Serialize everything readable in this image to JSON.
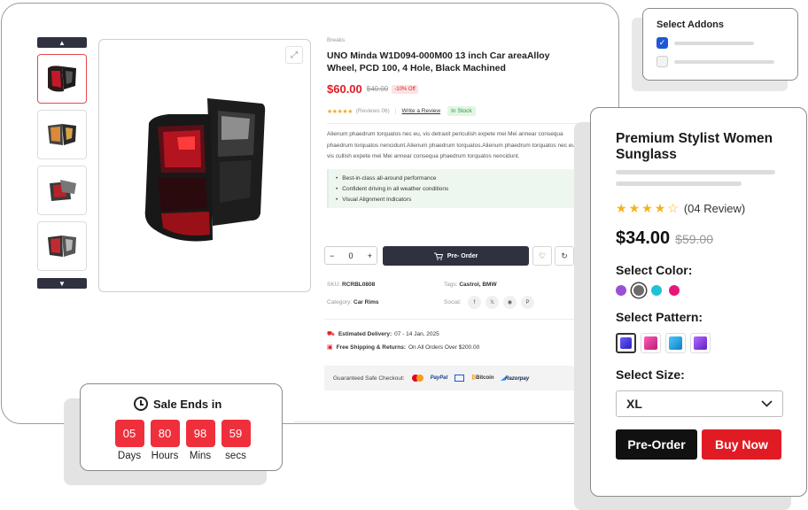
{
  "main": {
    "breadcrumb": "Breaks",
    "title": "UNO Minda W1D094-000M00 13 inch Car areaAlloy Wheel, PCD 100, 4 Hole, Black Machined",
    "price_now": "$60.00",
    "price_old": "$40.00",
    "discount": "-10% Off",
    "stars": "★★★★★",
    "reviews": "(Reviews 06)",
    "write_review": "Write a Review",
    "stock": "In Stock",
    "description": "Alienum phaedrum torquatos nec eu, vis detraxit periculish expete mei Mei annear consequa phaedrum torquatos nencidunt.Alienum phaedrum torquatos.Alienum phaedrum torquatos nec eu, vis cullish expete mei Mei annear consequa phaedrum torquatos nencidunt.",
    "bullets": [
      "Best-in-class all-around performance",
      "Confident driving in all weather conditions",
      "Visual Alignment Indicators"
    ],
    "qty": "0",
    "preorder": "Pre- Order",
    "sku_label": "SKU:",
    "sku": "RCRBL0808",
    "tags_label": "Tags:",
    "tags": "Castrol, BMW",
    "category_label": "Category:",
    "category": "Car Rims",
    "social_label": "Social:",
    "delivery_label": "Estimated Delivery:",
    "delivery": "07 - 14 Jan, 2025",
    "shipping_label": "Free Shipping & Returns:",
    "shipping": "On All Orders Over $200.00",
    "checkout_label": "Guaranteed Safe Checkout:",
    "payments": [
      "PayPal",
      "Bitcoin",
      "Razorpay"
    ]
  },
  "addons": {
    "title": "Select Addons",
    "checked_color": "#1e57d6"
  },
  "product": {
    "title": "Premium Stylist Women Sunglass",
    "rating_value": 4,
    "rating_max": 5,
    "reviews": "(04 Review)",
    "price_now": "$34.00",
    "price_old": "$59.00",
    "color_label": "Select Color:",
    "colors": [
      "#9b4fd6",
      "#6b6b6b",
      "#1ec2d6",
      "#e8157a"
    ],
    "pattern_label": "Select Pattern:",
    "patterns": [
      "#4a3fe0",
      "#e0389c",
      "#1ea6e6",
      "#8a3ae6"
    ],
    "size_label": "Select Size:",
    "size": "XL",
    "preorder": "Pre-Order",
    "buy_now": "Buy Now"
  },
  "sale": {
    "title": "Sale Ends in",
    "units": [
      {
        "value": "05",
        "label": "Days"
      },
      {
        "value": "80",
        "label": "Hours"
      },
      {
        "value": "98",
        "label": "Mins"
      },
      {
        "value": "59",
        "label": "secs"
      }
    ]
  }
}
